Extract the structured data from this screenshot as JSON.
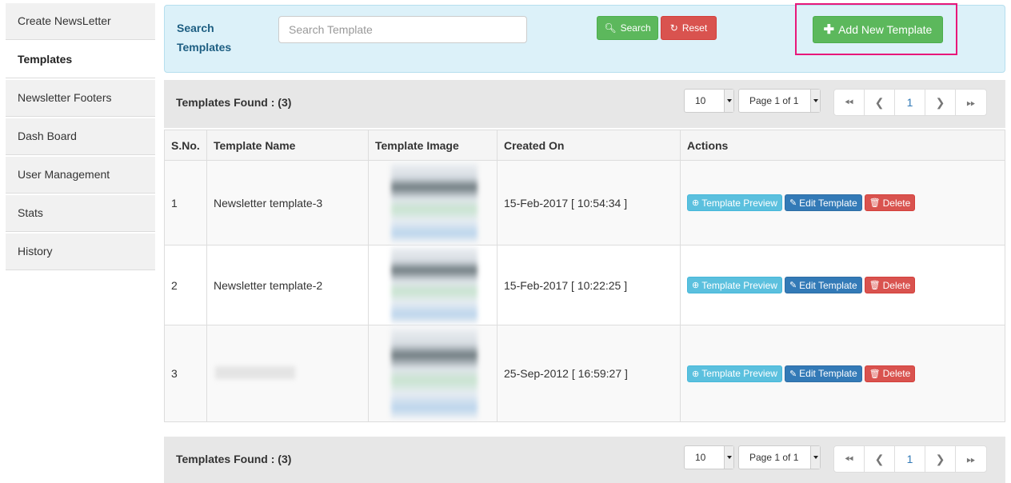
{
  "sidebar": {
    "items": [
      {
        "label": "Create NewsLetter"
      },
      {
        "label": "Templates",
        "active": true
      },
      {
        "label": "Newsletter Footers"
      },
      {
        "label": "Dash Board"
      },
      {
        "label": "User Management"
      },
      {
        "label": "Stats"
      },
      {
        "label": "History"
      }
    ]
  },
  "search": {
    "label": "Search Templates",
    "placeholder": "Search Template",
    "value": "",
    "search_button": "Search",
    "reset_button": "Reset",
    "add_button": "Add New Template"
  },
  "toolbar": {
    "found": "Templates Found : (3)",
    "page_size": "10",
    "page_select": "Page 1 of 1",
    "current_page": "1"
  },
  "table": {
    "headers": [
      "S.No.",
      "Template Name",
      "Template Image",
      "Created On",
      "Actions"
    ],
    "rows": [
      {
        "sno": "1",
        "name": "Newsletter template-3",
        "created": "15-Feb-2017 [ 10:54:34 ]"
      },
      {
        "sno": "2",
        "name": "Newsletter template-2",
        "created": "15-Feb-2017 [ 10:22:25 ]"
      },
      {
        "sno": "3",
        "name": "",
        "created": "25-Sep-2012 [ 16:59:27 ]"
      }
    ],
    "actions": {
      "preview": "Template Preview",
      "edit": "Edit Template",
      "delete": "Delete"
    }
  },
  "icons": {
    "search": "search-icon",
    "reset": "refresh-icon",
    "add": "plus-icon",
    "preview": "zoom-in-icon",
    "edit": "edit-icon",
    "delete": "trash-icon"
  },
  "colors": {
    "success": "#5cb85c",
    "danger": "#d9534f",
    "info": "#5bc0de",
    "primary": "#337ab7",
    "highlight": "#e8187a",
    "panel": "#dcf1f9"
  }
}
